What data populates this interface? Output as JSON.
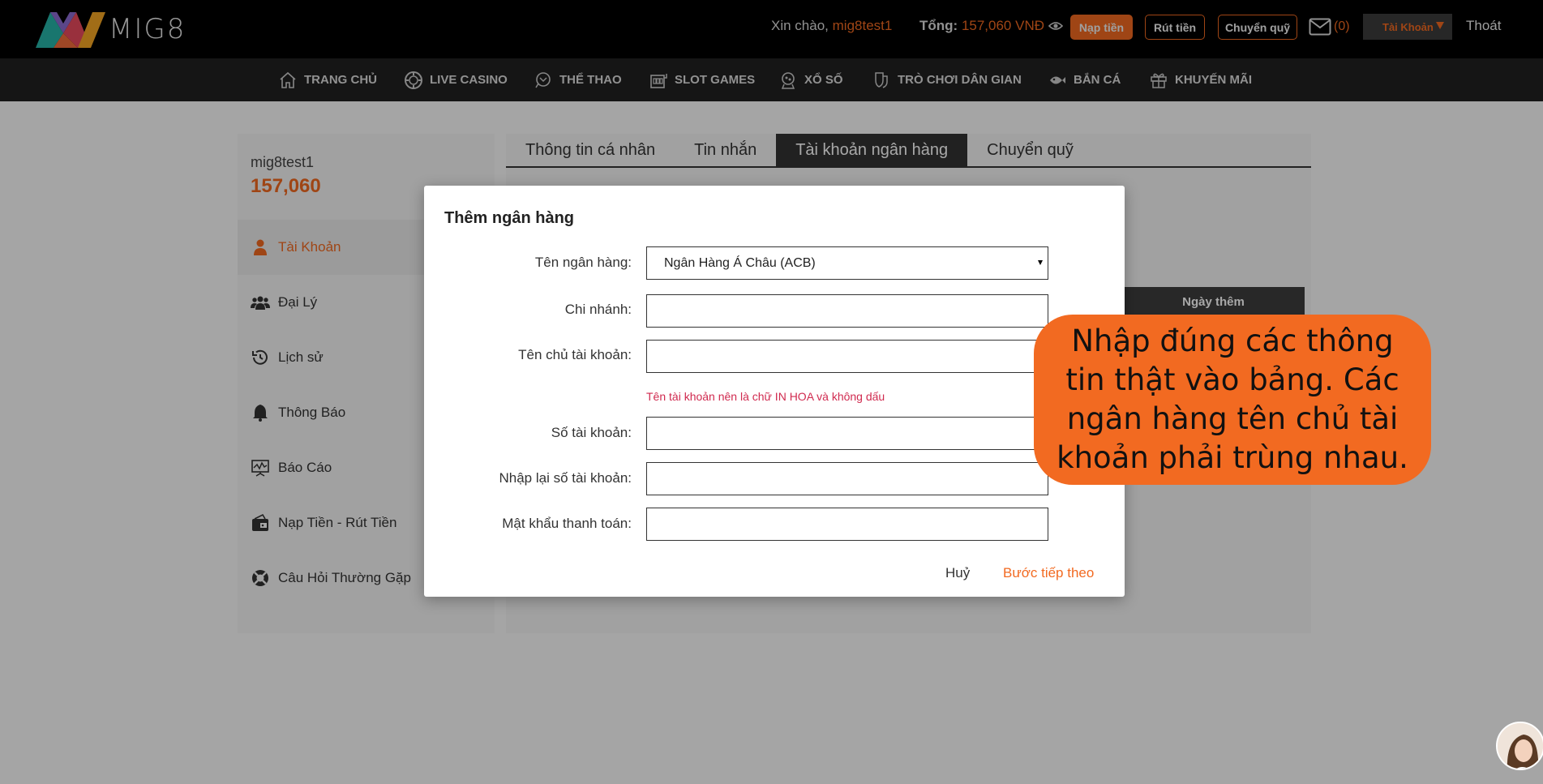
{
  "header": {
    "logo_text": "MIG8",
    "greeting": "Xin chào,",
    "username": "mig8test1",
    "total_label": "Tổng:",
    "total_amount": "157,060 VNĐ",
    "deposit_label": "Nạp tiền",
    "withdraw_label": "Rút tiền",
    "transfer_label": "Chuyển quỹ",
    "mail_count": "(0)",
    "account_label": "Tài Khoản",
    "logout_label": "Thoát"
  },
  "nav": {
    "items": [
      {
        "label": "TRANG CHỦ",
        "icon": "home-icon"
      },
      {
        "label": "LIVE CASINO",
        "icon": "casino-chip-icon"
      },
      {
        "label": "THỂ THAO",
        "icon": "sports-ball-icon"
      },
      {
        "label": "SLOT GAMES",
        "icon": "slot-machine-icon"
      },
      {
        "label": "XỔ SỐ",
        "icon": "lottery-icon"
      },
      {
        "label": "TRÒ CHƠI DÂN GIAN",
        "icon": "folk-game-icon"
      },
      {
        "label": "BẮN CÁ",
        "icon": "fish-icon"
      },
      {
        "label": "KHUYẾN MÃI",
        "icon": "gift-icon"
      }
    ]
  },
  "sidebar": {
    "username": "mig8test1",
    "balance": "157,060",
    "items": [
      {
        "label": "Tài Khoản",
        "icon": "user-icon"
      },
      {
        "label": "Đại Lý",
        "icon": "group-icon"
      },
      {
        "label": "Lịch sử",
        "icon": "history-icon"
      },
      {
        "label": "Thông Báo",
        "icon": "bell-icon"
      },
      {
        "label": "Báo Cáo",
        "icon": "report-icon"
      },
      {
        "label": "Nạp Tiền - Rút Tiền",
        "icon": "wallet-icon"
      },
      {
        "label": "Câu Hỏi Thường Gặp",
        "icon": "lifebuoy-icon"
      }
    ]
  },
  "tabs": [
    {
      "label": "Thông tin cá nhân"
    },
    {
      "label": "Tin nhắn"
    },
    {
      "label": "Tài khoản ngân hàng"
    },
    {
      "label": "Chuyển quỹ"
    }
  ],
  "table": {
    "date_added_header": "Ngày thêm"
  },
  "modal": {
    "title": "Thêm ngân hàng",
    "fields": {
      "bank_name_label": "Tên ngân hàng:",
      "bank_name_value": "Ngân Hàng Á Châu (ACB)",
      "branch_label": "Chi nhánh:",
      "holder_label": "Tên chủ tài khoản:",
      "holder_hint": "Tên tài khoản nên là chữ IN HOA và không dấu",
      "account_no_label": "Số tài khoản:",
      "account_no_confirm_label": "Nhập lại số tài khoản:",
      "payment_password_label": "Mật khẩu thanh toán:"
    },
    "cancel_label": "Huỷ",
    "next_label": "Bước tiếp theo"
  },
  "callout": {
    "text": "Nhập đúng các thông tin thật vào bảng. Các ngân hàng tên chủ tài khoản phải trùng nhau."
  },
  "colors": {
    "accent": "#f26a21",
    "topbar": "#000000",
    "nav": "#212121",
    "hint": "#d02a4f"
  }
}
